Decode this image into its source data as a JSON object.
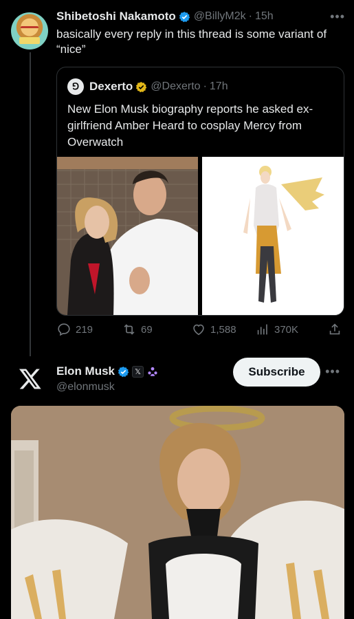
{
  "post1": {
    "author_name": "Shibetoshi Nakamoto",
    "handle": "@BillyM2k",
    "sep": "·",
    "time": "15h",
    "text": "basically every reply in this thread is some variant of “nice”",
    "more_icon": "ellipsis-icon"
  },
  "quote": {
    "author_name": "Dexerto",
    "logo_glyph": "⅁",
    "handle": "@Dexerto",
    "sep": "·",
    "time": "17h",
    "text": "New Elon Musk biography reports he asked ex-girlfriend Amber Heard to cosplay Mercy from Overwatch",
    "badge_color": "#e2b719"
  },
  "actions": {
    "replies": "219",
    "reposts": "69",
    "likes": "1,588",
    "views": "370K"
  },
  "post2": {
    "author_name": "Elon Musk",
    "badge_x": "𝕏",
    "handle": "@elonmusk",
    "subscribe_label": "Subscribe",
    "more_icon": "ellipsis-icon"
  },
  "colors": {
    "background": "#000000",
    "muted": "#71767b",
    "verified_blue": "#1d9bf0",
    "border": "#2f3336"
  }
}
